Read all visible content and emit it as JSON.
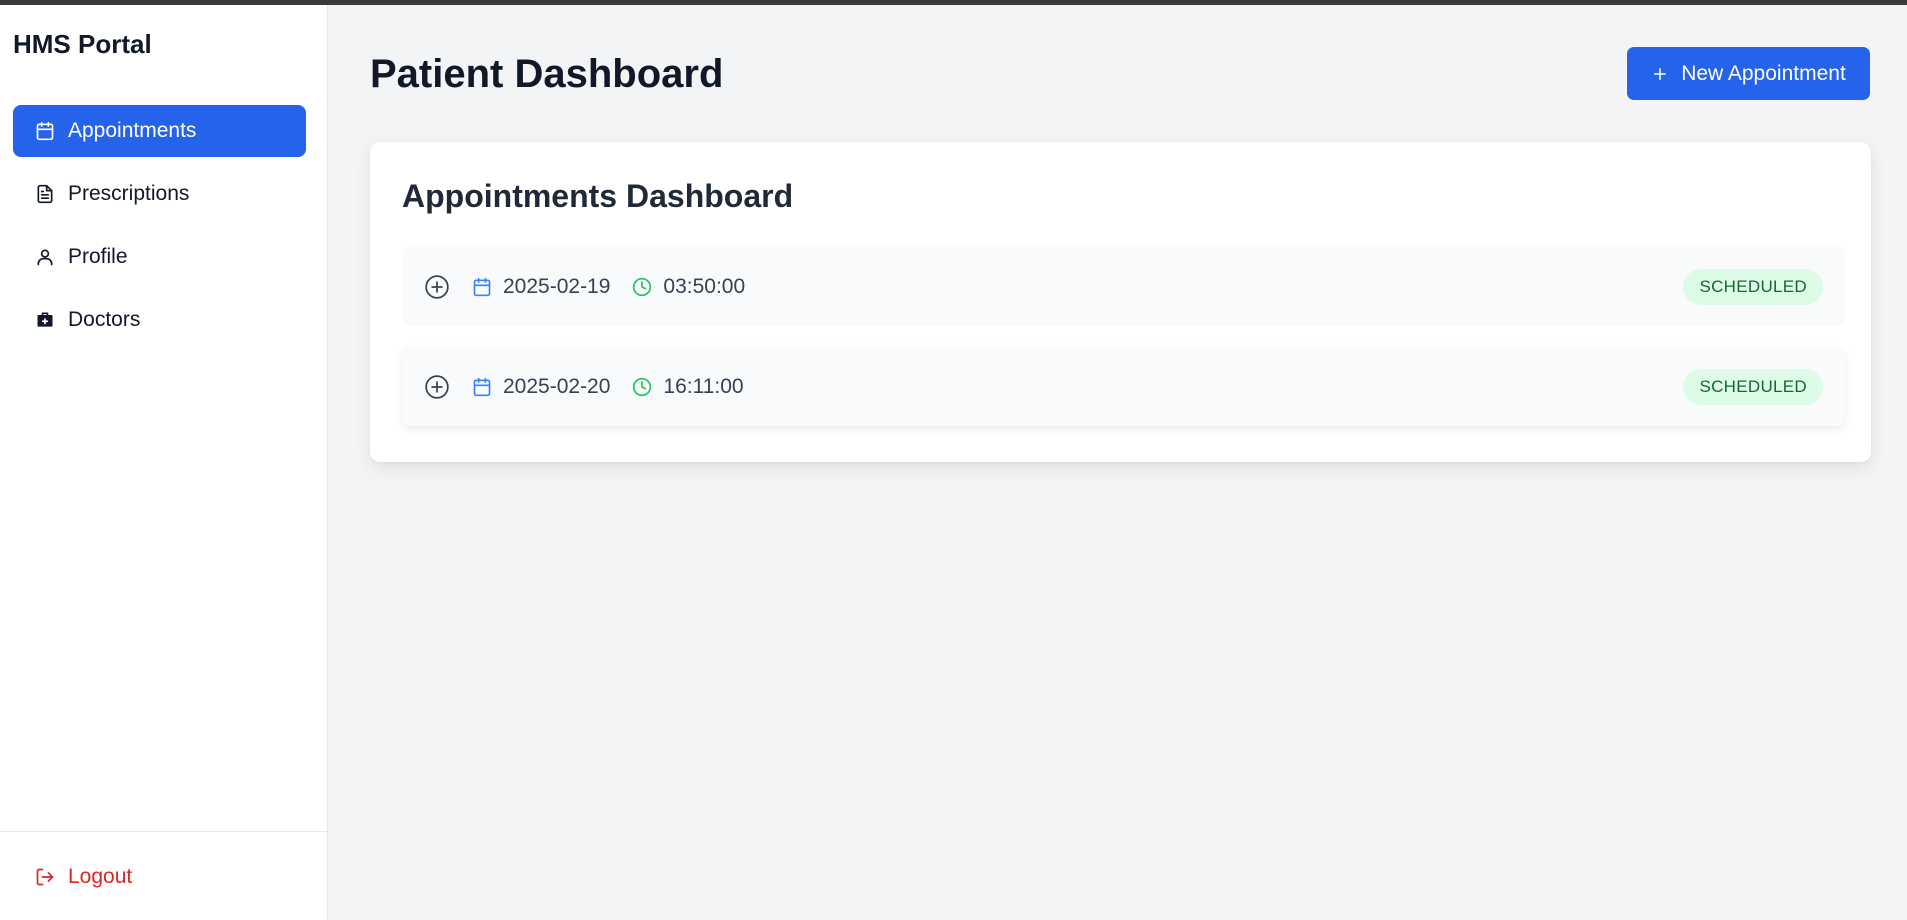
{
  "sidebar": {
    "brand": "HMS Portal",
    "items": [
      {
        "label": "Appointments",
        "icon": "calendar-icon",
        "active": true
      },
      {
        "label": "Prescriptions",
        "icon": "document-icon",
        "active": false
      },
      {
        "label": "Profile",
        "icon": "user-icon",
        "active": false
      },
      {
        "label": "Doctors",
        "icon": "medical-bag-icon",
        "active": false
      }
    ],
    "logout_label": "Logout"
  },
  "header": {
    "title": "Patient Dashboard",
    "new_appointment_label": "New Appointment"
  },
  "appointments": {
    "title": "Appointments Dashboard",
    "rows": [
      {
        "date": "2025-02-19",
        "time": "03:50:00",
        "status": "SCHEDULED"
      },
      {
        "date": "2025-02-20",
        "time": "16:11:00",
        "status": "SCHEDULED"
      }
    ]
  },
  "colors": {
    "accent": "#2563eb",
    "danger": "#dc2626",
    "status_bg": "#dcfce7",
    "status_text": "#166534",
    "time_icon": "#22c55e",
    "date_icon": "#3b82f6"
  }
}
